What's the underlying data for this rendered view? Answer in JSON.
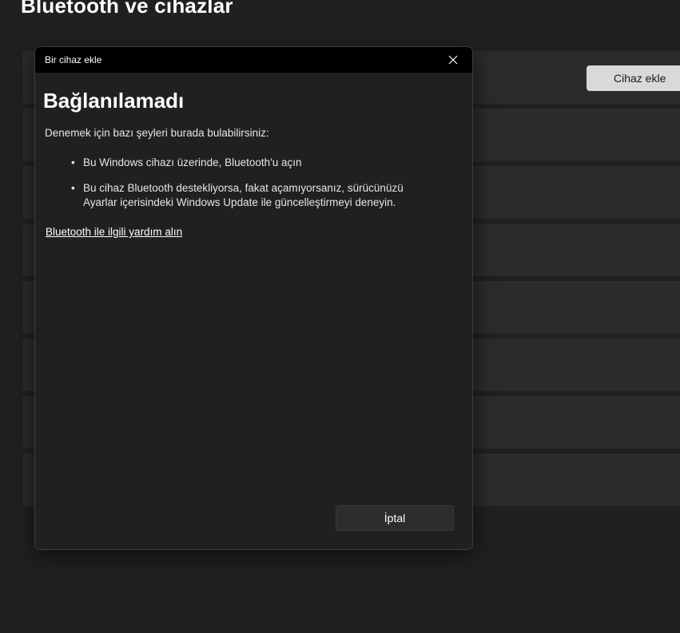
{
  "settings": {
    "page_title": "Bluetooth ve cihazlar",
    "add_device_label": "Cihaz ekle"
  },
  "dialog": {
    "window_title": "Bir cihaz ekle",
    "heading": "Bağlanılamadı",
    "intro": "Denemek için bazı şeyleri burada bulabilirsiniz:",
    "bullets": [
      "Bu Windows cihazı üzerinde, Bluetooth'u açın",
      "Bu cihaz Bluetooth destekliyorsa, fakat açamıyorsanız, sürücünüzü Ayarlar içerisindeki Windows Update ile güncelleştirmeyi deneyin."
    ],
    "help_link": "Bluetooth ile ilgili yardım alın",
    "cancel_label": "İptal"
  },
  "colors": {
    "background": "#202020",
    "row": "#2b2b2b",
    "titlebar": "#000000",
    "accent_button": "#d9d9d9"
  },
  "icons": {
    "close": "close-icon",
    "bullet": "bullet-icon"
  }
}
